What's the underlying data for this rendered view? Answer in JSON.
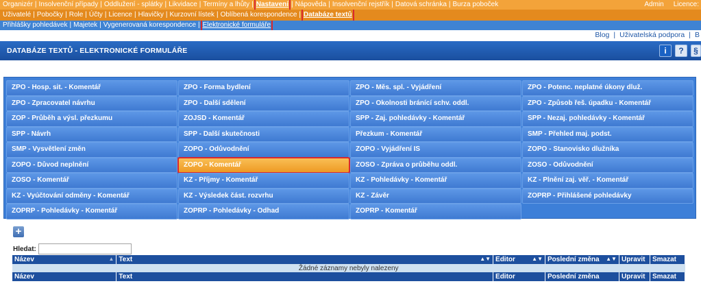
{
  "top_menu": {
    "items": [
      "Organizér",
      "Insolvenční případy",
      "Oddlužení - splátky",
      "Likvidace",
      "Termíny a lhůty",
      "Nastavení",
      "Nápověda",
      "Insolvenční rejstřík",
      "Datová schránka",
      "Burza poboček"
    ],
    "active": "Nastavení",
    "user": "Admin",
    "licence": "Licence:"
  },
  "sub_menu": {
    "items": [
      "Uživatelé",
      "Pobočky",
      "Role",
      "Účty",
      "Licence",
      "Hlavičky",
      "Kurzovní lístek",
      "Oblíbená korespondence",
      "Databáze textů"
    ],
    "active": "Databáze textů"
  },
  "third_menu": {
    "items": [
      "Přihlášky pohledávek",
      "Majetek",
      "Vygenerovaná korespondence",
      "Elektronické formuláře"
    ],
    "active": "Elektronické formuláře"
  },
  "links": {
    "blog": "Blog",
    "support": "Uživatelská podpora",
    "more": "B"
  },
  "title": "DATABÁZE TEXTŮ - ELEKTRONICKÉ FORMULÁŘE",
  "toolbar_icons": {
    "info": "i",
    "help": "?",
    "other": "§"
  },
  "forms": [
    "ZPO - Hosp. sit. - Komentář",
    "ZPO - Forma bydlení",
    "ZPO - Měs. spl. - Vyjádření",
    "ZPO - Potenc. neplatné úkony dluž.",
    "ZPO - Zpracovatel návrhu",
    "ZPO - Další sdělení",
    "ZPO - Okolnosti bránící schv. oddl.",
    "ZPO - Způsob řeš. úpadku - Komentář",
    "ZOP - Průběh a výsl. přezkumu",
    "ZOJSD - Komentář",
    "SPP - Zaj. pohledávky - Komentář",
    "SPP - Nezaj. pohledávky - Komentář",
    "SPP - Návrh",
    "SPP - Další skutečnosti",
    "Přezkum - Komentář",
    "SMP - Přehled maj. podst.",
    "SMP - Vysvětlení změn",
    "ZOPO - Odůvodnění",
    "ZOPO - Vyjádření IS",
    "ZOPO - Stanovisko dlužníka",
    "ZOPO - Důvod neplnění",
    "ZOPO - Komentář",
    "ZOSO - Zpráva o průběhu oddl.",
    "ZOSO - Odůvodnění",
    "ZOSO - Komentář",
    "KZ - Příjmy - Komentář",
    "KZ - Pohledávky - Komentář",
    "KZ - Plnění zaj. věř. - Komentář",
    "KZ - Vyúčtování odměny - Komentář",
    "KZ - Výsledek část. rozvrhu",
    "KZ - Závěr",
    "ZOPRP - Přihlášené pohledávky",
    "ZOPRP - Pohledávky - Komentář",
    "ZOPRP - Pohledávky - Odhad",
    "ZOPRP - Komentář"
  ],
  "selected_form": "ZOPO - Komentář",
  "search": {
    "label": "Hledat:",
    "value": ""
  },
  "table": {
    "columns": [
      "Název",
      "Text",
      "Editor",
      "Poslední změna",
      "Upravit",
      "Smazat"
    ],
    "empty_message": "Žádné záznamy nebyly nalezeny"
  },
  "colors": {
    "menu_orange": "#f3a33a",
    "menu_dark_orange": "#e48a1e",
    "blue": "#3d7fd8",
    "header_blue": "#1d4f9e",
    "highlight_red": "#d8282e"
  }
}
